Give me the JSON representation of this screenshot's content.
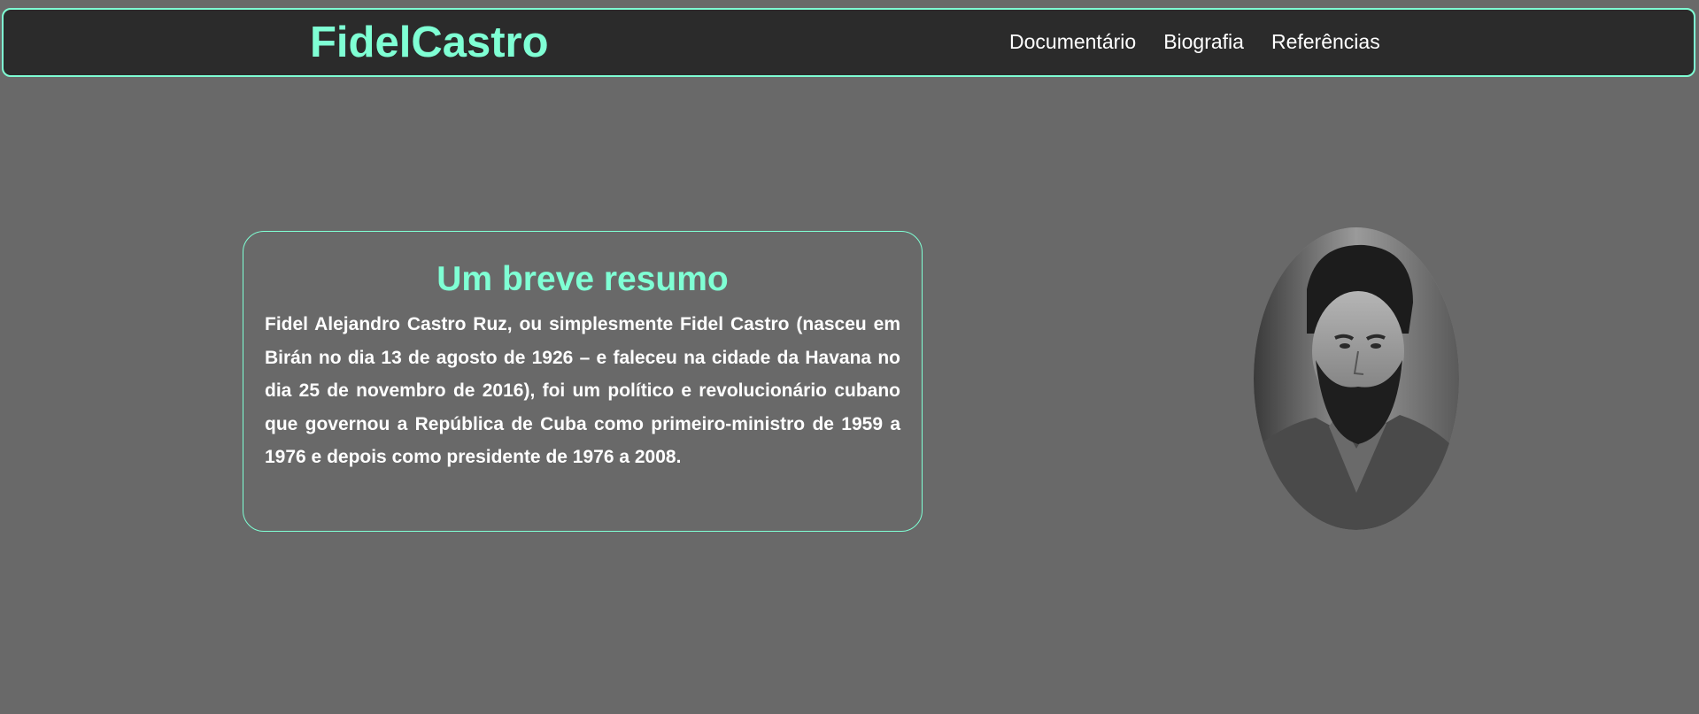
{
  "header": {
    "logo": "FidelCastro",
    "nav": [
      {
        "label": "Documentário"
      },
      {
        "label": "Biografia"
      },
      {
        "label": "Referências"
      }
    ]
  },
  "summary": {
    "title": "Um breve resumo",
    "text": "Fidel Alejandro Castro Ruz, ou simplesmente Fidel Castro (nasceu em Birán no dia 13 de agosto de 1926 – e faleceu na cidade da Havana no dia 25 de novembro de 2016), foi um político e revolucionário cubano que governou a República de Cuba como primeiro-ministro de 1959 a 1976 e depois como presidente de 1976 a 2008."
  },
  "colors": {
    "accent": "#7fffd4",
    "page_background": "#696969",
    "header_background": "#2b2b2b",
    "text": "#ffffff"
  }
}
